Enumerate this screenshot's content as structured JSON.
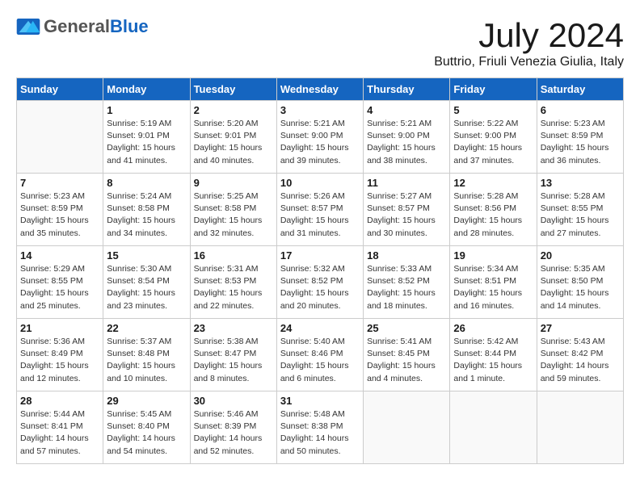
{
  "header": {
    "logo_general": "General",
    "logo_blue": "Blue",
    "month_title": "July 2024",
    "location": "Buttrio, Friuli Venezia Giulia, Italy"
  },
  "columns": [
    "Sunday",
    "Monday",
    "Tuesday",
    "Wednesday",
    "Thursday",
    "Friday",
    "Saturday"
  ],
  "weeks": [
    [
      {
        "day": "",
        "info": ""
      },
      {
        "day": "1",
        "info": "Sunrise: 5:19 AM\nSunset: 9:01 PM\nDaylight: 15 hours\nand 41 minutes."
      },
      {
        "day": "2",
        "info": "Sunrise: 5:20 AM\nSunset: 9:01 PM\nDaylight: 15 hours\nand 40 minutes."
      },
      {
        "day": "3",
        "info": "Sunrise: 5:21 AM\nSunset: 9:00 PM\nDaylight: 15 hours\nand 39 minutes."
      },
      {
        "day": "4",
        "info": "Sunrise: 5:21 AM\nSunset: 9:00 PM\nDaylight: 15 hours\nand 38 minutes."
      },
      {
        "day": "5",
        "info": "Sunrise: 5:22 AM\nSunset: 9:00 PM\nDaylight: 15 hours\nand 37 minutes."
      },
      {
        "day": "6",
        "info": "Sunrise: 5:23 AM\nSunset: 8:59 PM\nDaylight: 15 hours\nand 36 minutes."
      }
    ],
    [
      {
        "day": "7",
        "info": "Sunrise: 5:23 AM\nSunset: 8:59 PM\nDaylight: 15 hours\nand 35 minutes."
      },
      {
        "day": "8",
        "info": "Sunrise: 5:24 AM\nSunset: 8:58 PM\nDaylight: 15 hours\nand 34 minutes."
      },
      {
        "day": "9",
        "info": "Sunrise: 5:25 AM\nSunset: 8:58 PM\nDaylight: 15 hours\nand 32 minutes."
      },
      {
        "day": "10",
        "info": "Sunrise: 5:26 AM\nSunset: 8:57 PM\nDaylight: 15 hours\nand 31 minutes."
      },
      {
        "day": "11",
        "info": "Sunrise: 5:27 AM\nSunset: 8:57 PM\nDaylight: 15 hours\nand 30 minutes."
      },
      {
        "day": "12",
        "info": "Sunrise: 5:28 AM\nSunset: 8:56 PM\nDaylight: 15 hours\nand 28 minutes."
      },
      {
        "day": "13",
        "info": "Sunrise: 5:28 AM\nSunset: 8:55 PM\nDaylight: 15 hours\nand 27 minutes."
      }
    ],
    [
      {
        "day": "14",
        "info": "Sunrise: 5:29 AM\nSunset: 8:55 PM\nDaylight: 15 hours\nand 25 minutes."
      },
      {
        "day": "15",
        "info": "Sunrise: 5:30 AM\nSunset: 8:54 PM\nDaylight: 15 hours\nand 23 minutes."
      },
      {
        "day": "16",
        "info": "Sunrise: 5:31 AM\nSunset: 8:53 PM\nDaylight: 15 hours\nand 22 minutes."
      },
      {
        "day": "17",
        "info": "Sunrise: 5:32 AM\nSunset: 8:52 PM\nDaylight: 15 hours\nand 20 minutes."
      },
      {
        "day": "18",
        "info": "Sunrise: 5:33 AM\nSunset: 8:52 PM\nDaylight: 15 hours\nand 18 minutes."
      },
      {
        "day": "19",
        "info": "Sunrise: 5:34 AM\nSunset: 8:51 PM\nDaylight: 15 hours\nand 16 minutes."
      },
      {
        "day": "20",
        "info": "Sunrise: 5:35 AM\nSunset: 8:50 PM\nDaylight: 15 hours\nand 14 minutes."
      }
    ],
    [
      {
        "day": "21",
        "info": "Sunrise: 5:36 AM\nSunset: 8:49 PM\nDaylight: 15 hours\nand 12 minutes."
      },
      {
        "day": "22",
        "info": "Sunrise: 5:37 AM\nSunset: 8:48 PM\nDaylight: 15 hours\nand 10 minutes."
      },
      {
        "day": "23",
        "info": "Sunrise: 5:38 AM\nSunset: 8:47 PM\nDaylight: 15 hours\nand 8 minutes."
      },
      {
        "day": "24",
        "info": "Sunrise: 5:40 AM\nSunset: 8:46 PM\nDaylight: 15 hours\nand 6 minutes."
      },
      {
        "day": "25",
        "info": "Sunrise: 5:41 AM\nSunset: 8:45 PM\nDaylight: 15 hours\nand 4 minutes."
      },
      {
        "day": "26",
        "info": "Sunrise: 5:42 AM\nSunset: 8:44 PM\nDaylight: 15 hours\nand 1 minute."
      },
      {
        "day": "27",
        "info": "Sunrise: 5:43 AM\nSunset: 8:42 PM\nDaylight: 14 hours\nand 59 minutes."
      }
    ],
    [
      {
        "day": "28",
        "info": "Sunrise: 5:44 AM\nSunset: 8:41 PM\nDaylight: 14 hours\nand 57 minutes."
      },
      {
        "day": "29",
        "info": "Sunrise: 5:45 AM\nSunset: 8:40 PM\nDaylight: 14 hours\nand 54 minutes."
      },
      {
        "day": "30",
        "info": "Sunrise: 5:46 AM\nSunset: 8:39 PM\nDaylight: 14 hours\nand 52 minutes."
      },
      {
        "day": "31",
        "info": "Sunrise: 5:48 AM\nSunset: 8:38 PM\nDaylight: 14 hours\nand 50 minutes."
      },
      {
        "day": "",
        "info": ""
      },
      {
        "day": "",
        "info": ""
      },
      {
        "day": "",
        "info": ""
      }
    ]
  ]
}
